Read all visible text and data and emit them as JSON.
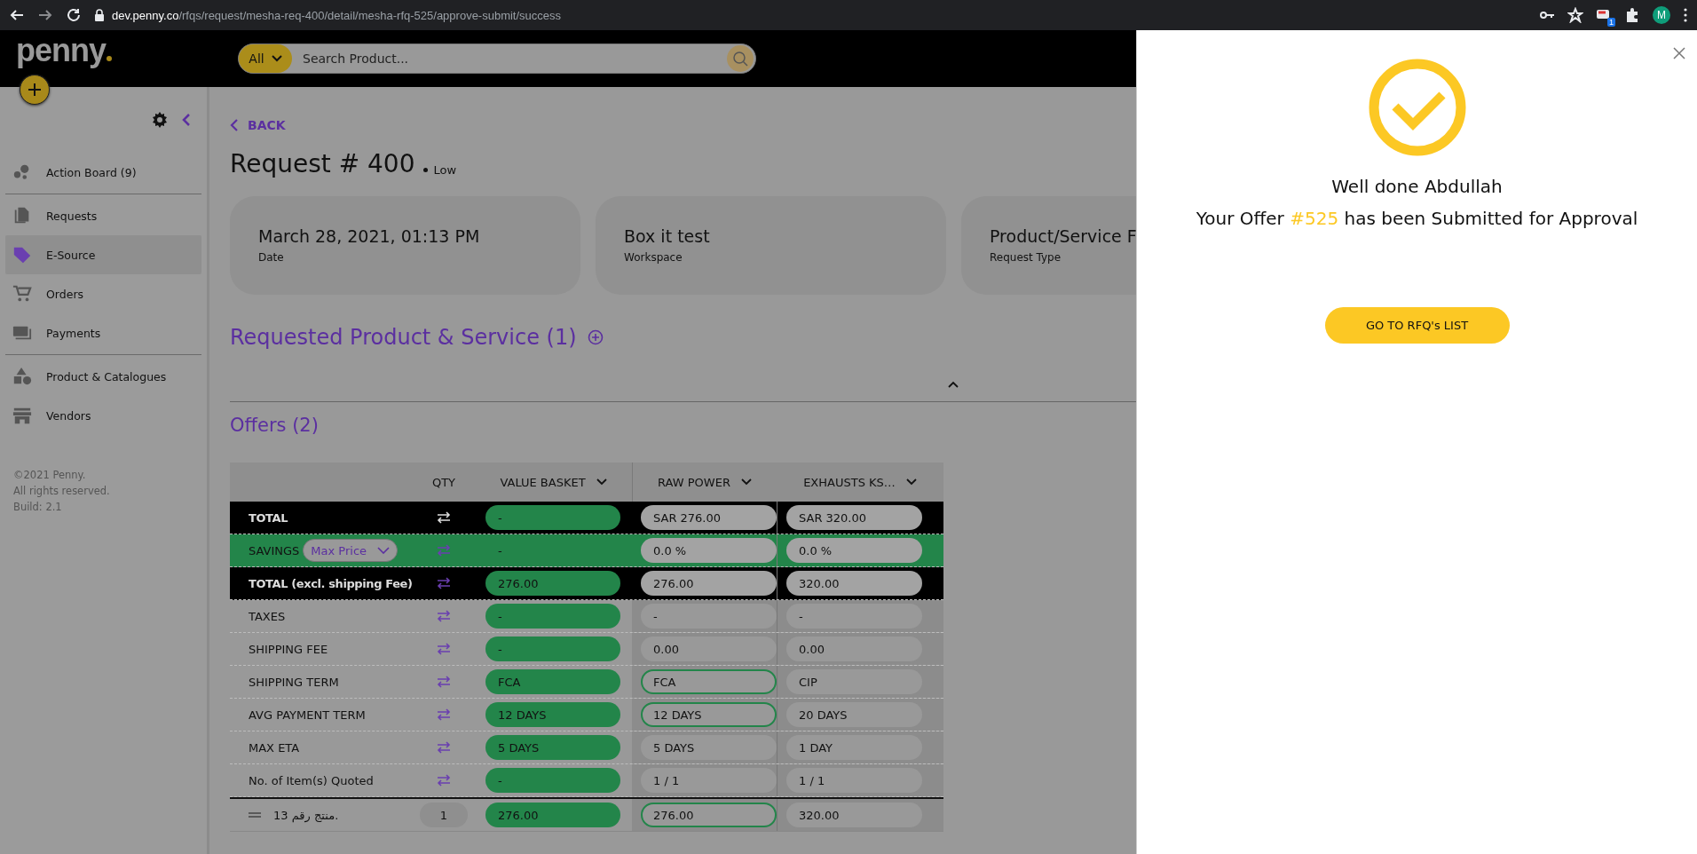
{
  "browser": {
    "url_host": "dev.penny.co",
    "url_path": "/rfqs/request/mesha-req-400/detail/mesha-rfq-525/approve-submit/success",
    "extension_badge": "1",
    "profile_initial": "M"
  },
  "header": {
    "logo": "penny",
    "search": {
      "scope": "All",
      "placeholder": "Search Product..."
    }
  },
  "sidebar": {
    "groups": [
      [
        {
          "label": "Action Board (9)",
          "selected": false
        }
      ],
      [
        {
          "label": "Requests",
          "selected": false
        },
        {
          "label": "E-Source",
          "selected": true
        },
        {
          "label": "Orders",
          "selected": false
        },
        {
          "label": "Payments",
          "selected": false
        }
      ],
      [
        {
          "label": "Product & Catalogues",
          "selected": false
        },
        {
          "label": "Vendors",
          "selected": false
        }
      ]
    ],
    "footer": [
      "©2021 Penny.",
      "All rights reserved.",
      "Build: 2.1"
    ]
  },
  "main": {
    "back": "BACK",
    "title": "Request # 400",
    "priority": "Low",
    "cards": [
      {
        "value": "March 28, 2021, 01:13 PM",
        "label": "Date"
      },
      {
        "value": "Box it test",
        "label": "Workspace"
      },
      {
        "value": "Product/Service F",
        "label": "Request Type"
      }
    ],
    "requested_heading": "Requested Product & Service (1)",
    "offers_heading": "Offers (2)"
  },
  "table": {
    "columns": [
      {
        "label": "QTY",
        "dropdown": false
      },
      {
        "label": "VALUE BASKET",
        "dropdown": true
      },
      {
        "label": "RAW POWER",
        "dropdown": true
      },
      {
        "label": "EXHAUSTS KS…",
        "dropdown": true
      }
    ],
    "rows": [
      {
        "kind": "total",
        "label": "TOTAL",
        "basket": "-",
        "offers": [
          {
            "text": "SAR 276.00",
            "outlined": false
          },
          {
            "text": "SAR 320.00",
            "outlined": false
          }
        ]
      },
      {
        "kind": "savings",
        "label": "SAVINGS",
        "selector": "Max Price",
        "basket": "-",
        "offers": [
          {
            "text": "0.0 %",
            "outlined": false
          },
          {
            "text": "0.0 %",
            "outlined": false
          }
        ]
      },
      {
        "kind": "total",
        "label": "TOTAL (excl. shipping Fee)",
        "basket": "276.00",
        "offers": [
          {
            "text": "276.00",
            "outlined": false
          },
          {
            "text": "320.00",
            "outlined": false
          }
        ]
      },
      {
        "kind": "plain",
        "label": "TAXES",
        "basket": "-",
        "offers": [
          {
            "text": "-",
            "outlined": false
          },
          {
            "text": "-",
            "outlined": false
          }
        ]
      },
      {
        "kind": "plain",
        "label": "SHIPPING FEE",
        "basket": "-",
        "offers": [
          {
            "text": "0.00",
            "outlined": false
          },
          {
            "text": "0.00",
            "outlined": false
          }
        ]
      },
      {
        "kind": "plain",
        "label": "SHIPPING TERM",
        "basket": "FCA",
        "offers": [
          {
            "text": "FCA",
            "outlined": true
          },
          {
            "text": "CIP",
            "outlined": false
          }
        ]
      },
      {
        "kind": "plain",
        "label": "AVG PAYMENT TERM",
        "basket": "12 DAYS",
        "offers": [
          {
            "text": "12 DAYS",
            "outlined": true
          },
          {
            "text": "20 DAYS",
            "outlined": false
          }
        ]
      },
      {
        "kind": "plain",
        "label": "MAX ETA",
        "basket": "5 DAYS",
        "offers": [
          {
            "text": "5 DAYS",
            "outlined": false
          },
          {
            "text": "1 DAY",
            "outlined": false
          }
        ]
      },
      {
        "kind": "plain",
        "label": "No. of Item(s) Quoted",
        "basket": "-",
        "offers": [
          {
            "text": "1 / 1",
            "outlined": false
          },
          {
            "text": "1 / 1",
            "outlined": false
          }
        ]
      },
      {
        "kind": "item",
        "label": "منتج رقم 13.",
        "qty": "1",
        "basket": "276.00",
        "offers": [
          {
            "text": "276.00",
            "outlined": true
          },
          {
            "text": "320.00",
            "outlined": false
          }
        ]
      }
    ]
  },
  "panel": {
    "greeting": "Well done Abdullah",
    "message_before": "Your Offer ",
    "offer_number": "#525",
    "message_after": " has been Submitted for Approval",
    "button": "GO TO RFQ's LIST"
  }
}
